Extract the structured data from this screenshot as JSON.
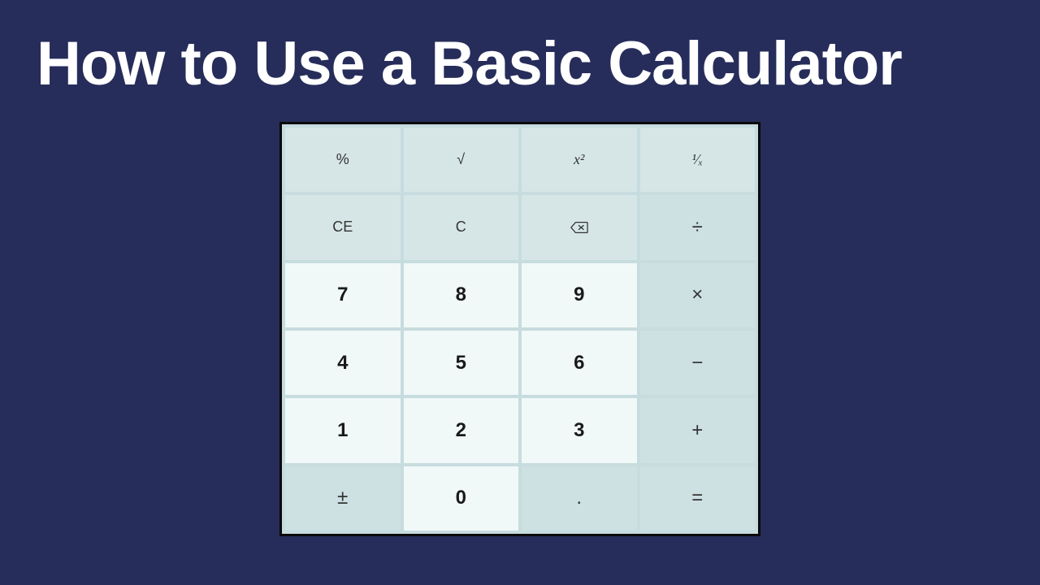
{
  "title": "How to Use a Basic Calculator",
  "keys": {
    "percent": "%",
    "sqrt": "√",
    "square": "x²",
    "reciprocal": "¹⁄ₓ",
    "ce": "CE",
    "c": "C",
    "divide": "÷",
    "multiply": "×",
    "subtract": "−",
    "add": "+",
    "equals": "=",
    "plusminus": "±",
    "decimal": ".",
    "n0": "0",
    "n1": "1",
    "n2": "2",
    "n3": "3",
    "n4": "4",
    "n5": "5",
    "n6": "6",
    "n7": "7",
    "n8": "8",
    "n9": "9"
  }
}
